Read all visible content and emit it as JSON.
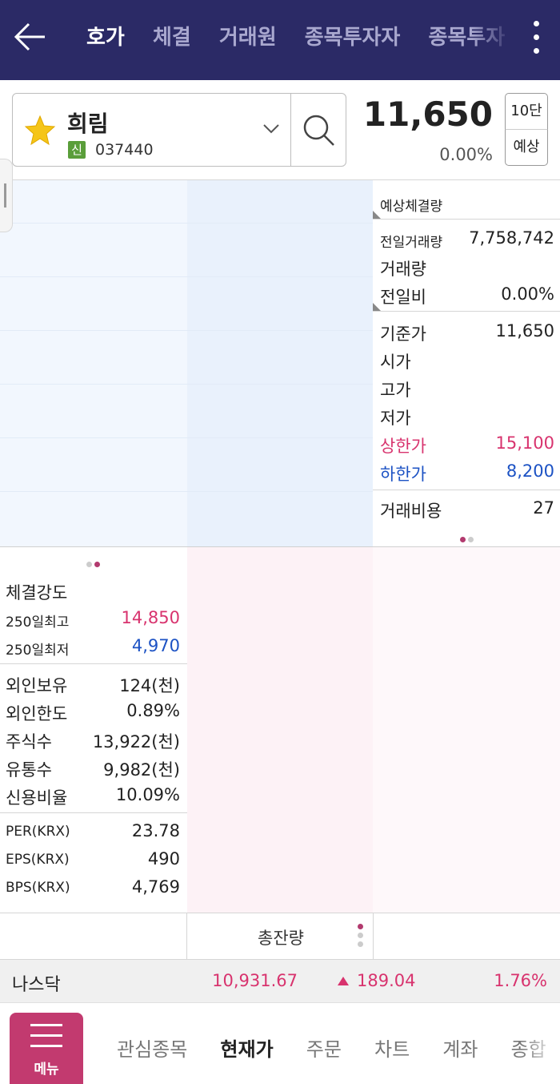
{
  "header": {
    "tabs": [
      {
        "label": "호가",
        "active": true
      },
      {
        "label": "체결",
        "active": false
      },
      {
        "label": "거래원",
        "active": false
      },
      {
        "label": "종목투자자",
        "active": false
      },
      {
        "label": "종목투자",
        "active": false
      }
    ]
  },
  "stock": {
    "name": "희림",
    "badge": "신",
    "code": "037440",
    "price": "11,650",
    "change_pct": "0.00%",
    "level_label": "10단",
    "predict_label": "예상"
  },
  "info_panel": {
    "expected_volume_label": "예상체결량",
    "prev_volume_label": "전일거래량",
    "prev_volume_value": "7,758,742",
    "volume_label": "거래량",
    "vs_prev_label": "전일비",
    "vs_prev_value": "0.00%",
    "base_price_label": "기준가",
    "base_price_value": "11,650",
    "open_label": "시가",
    "high_label": "고가",
    "low_label": "저가",
    "upper_limit_label": "상한가",
    "upper_limit_value": "15,100",
    "lower_limit_label": "하한가",
    "lower_limit_value": "8,200",
    "trade_cost_label": "거래비용",
    "trade_cost_value": "27"
  },
  "stats": {
    "strength_label": "체결강도",
    "high250_label": "250일최고",
    "high250_value": "14,850",
    "low250_label": "250일최저",
    "low250_value": "4,970",
    "foreign_hold_label": "외인보유",
    "foreign_hold_value": "124(천)",
    "foreign_limit_label": "외인한도",
    "foreign_limit_value": "0.89%",
    "shares_label": "주식수",
    "shares_value": "13,922(천)",
    "float_label": "유통수",
    "float_value": "9,982(천)",
    "credit_label": "신용비율",
    "credit_value": "10.09%",
    "per_label": "PER(KRX)",
    "per_value": "23.78",
    "eps_label": "EPS(KRX)",
    "eps_value": "490",
    "bps_label": "BPS(KRX)",
    "bps_value": "4,769"
  },
  "total": {
    "label": "총잔량"
  },
  "ticker": {
    "name": "나스닥",
    "value": "10,931.67",
    "change": "189.04",
    "pct": "1.76%"
  },
  "bottom_nav": {
    "menu_label": "메뉴",
    "items": [
      {
        "label": "관심종목",
        "active": false
      },
      {
        "label": "현재가",
        "active": true
      },
      {
        "label": "주문",
        "active": false
      },
      {
        "label": "차트",
        "active": false
      },
      {
        "label": "계좌",
        "active": false
      },
      {
        "label": "종합",
        "active": false
      }
    ]
  },
  "colors": {
    "header_bg": "#2b2a66",
    "up_red": "#d8336e",
    "down_blue": "#1c52c4",
    "menu_bg": "#c23a6f"
  }
}
